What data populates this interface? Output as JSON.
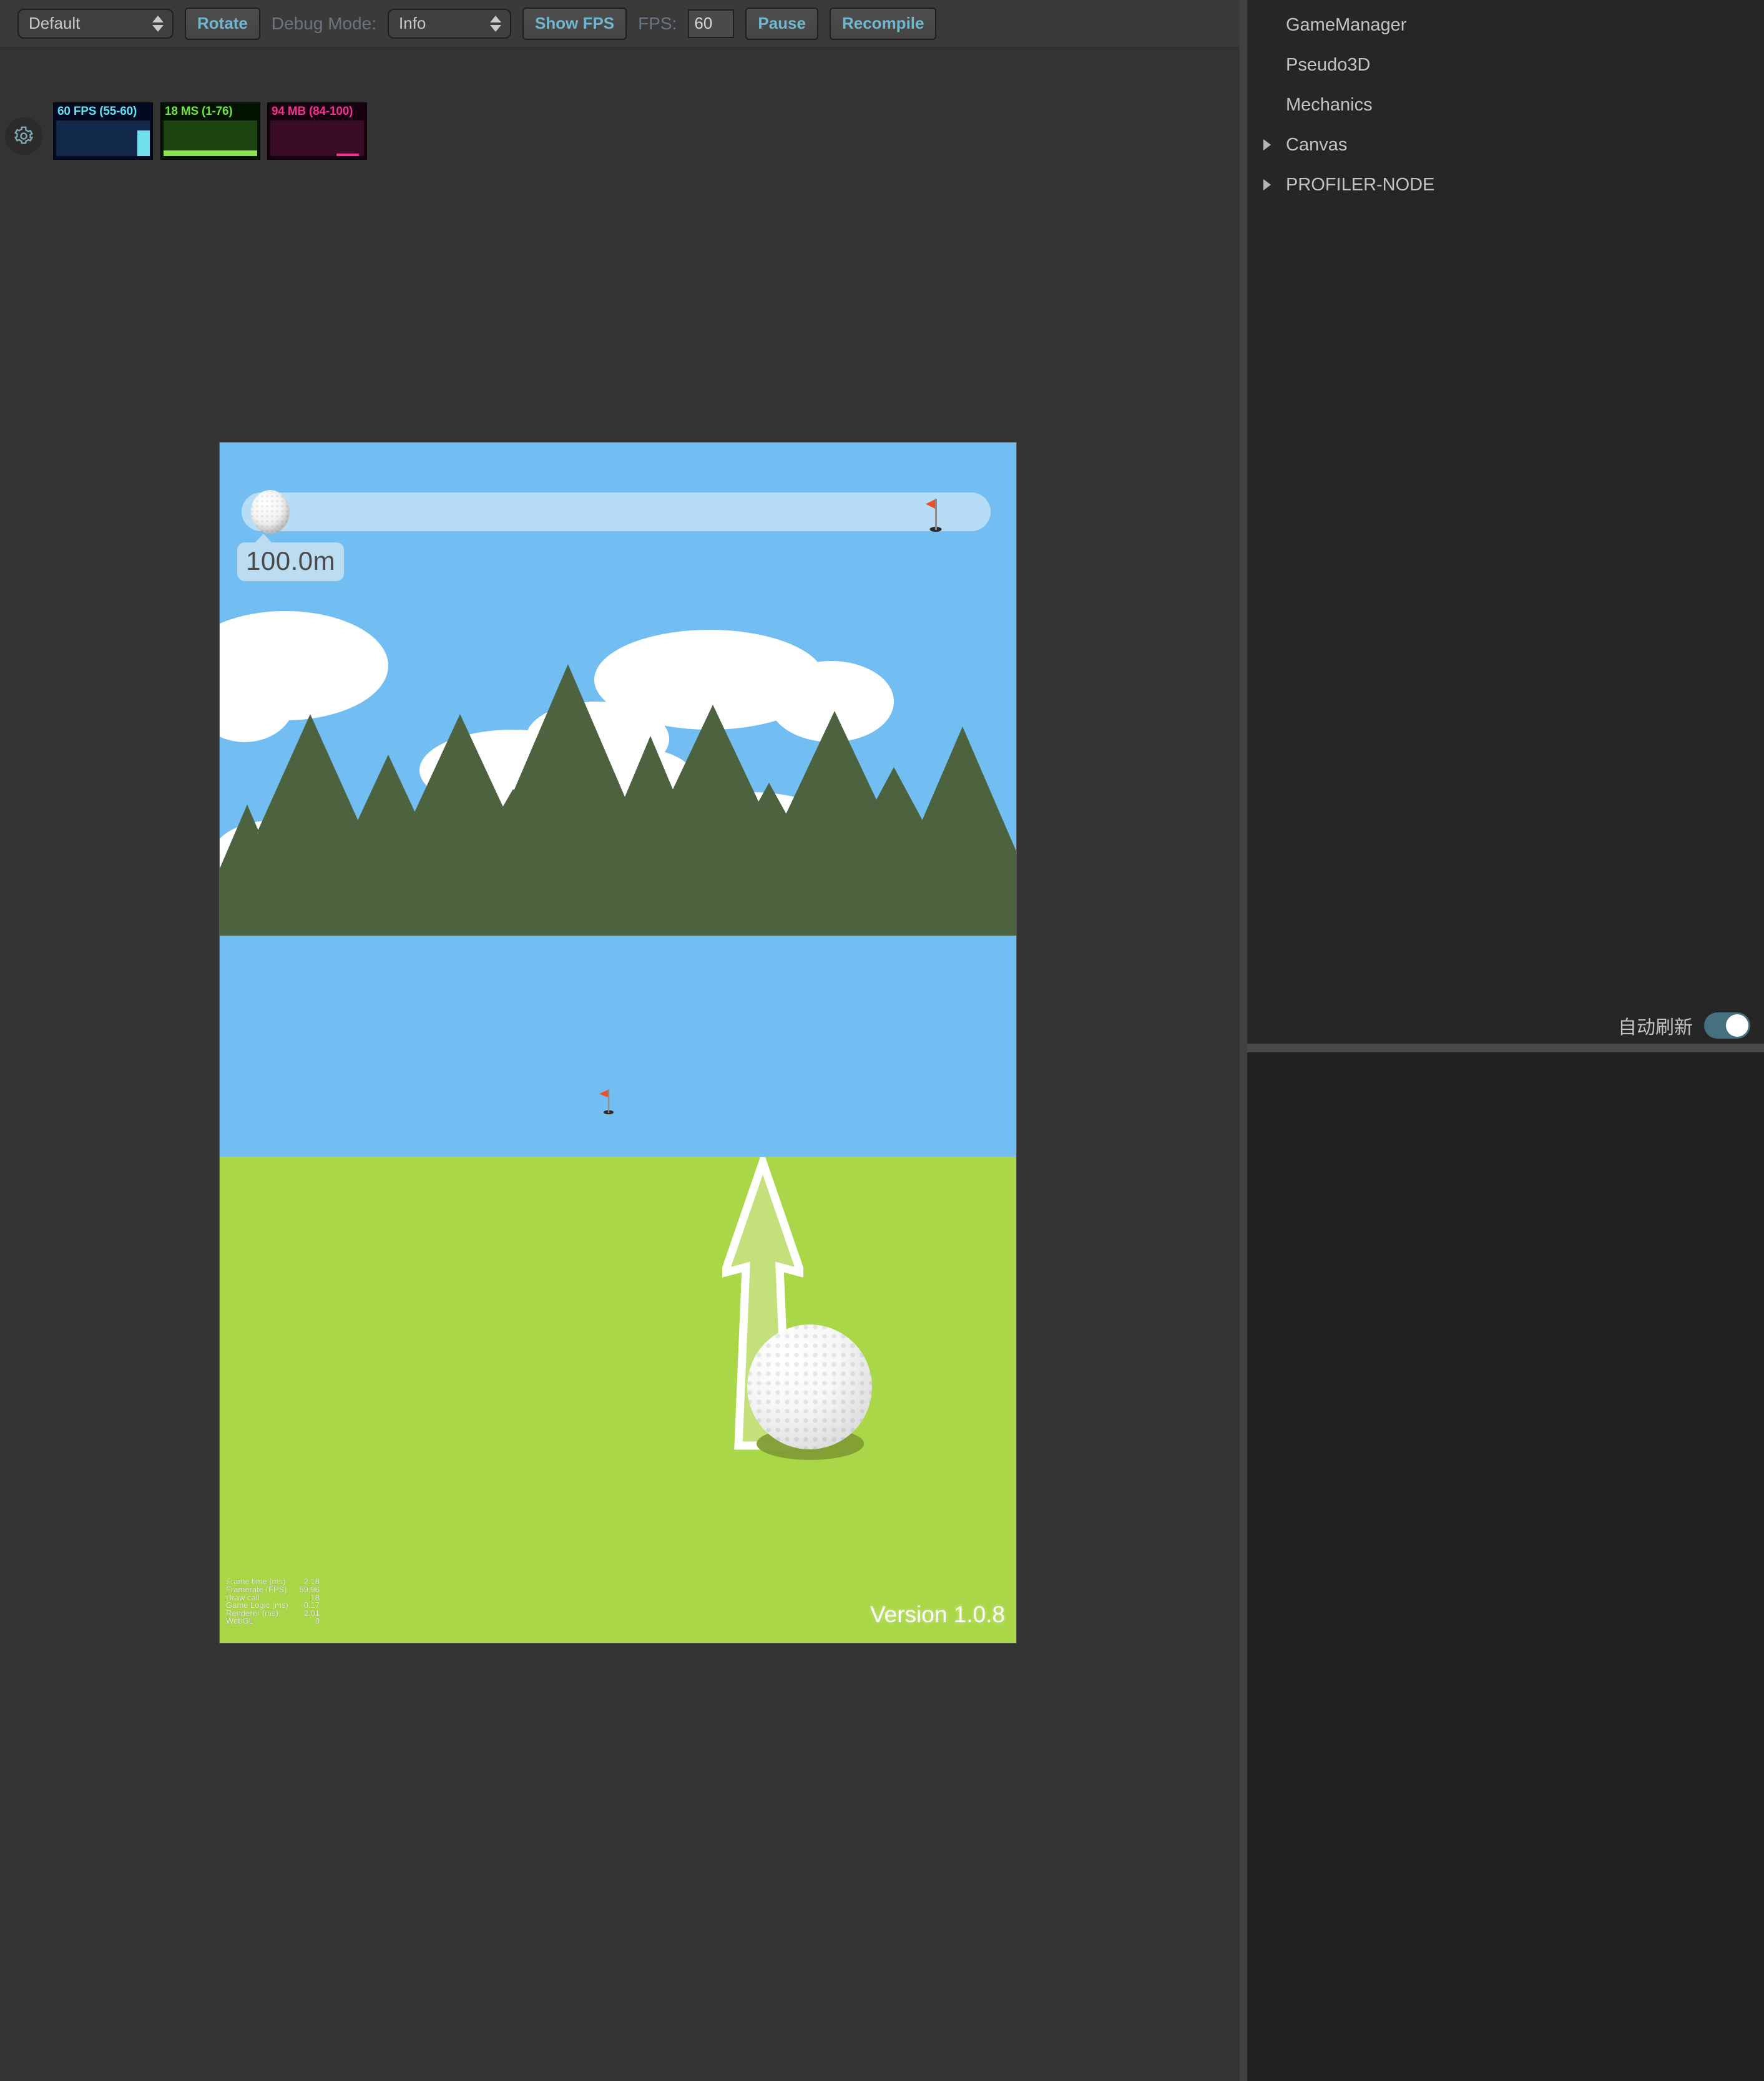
{
  "toolbar": {
    "scene_select": {
      "value": "Default",
      "icon": "chevron-updown-icon"
    },
    "rotate_button": "Rotate",
    "debug_mode_label": "Debug Mode:",
    "debug_mode_select": {
      "value": "Info"
    },
    "show_fps_button": "Show FPS",
    "fps_label": "FPS:",
    "fps_value": "60",
    "pause_button": "Pause",
    "recompile_button": "Recompile",
    "accent_color": "#6fb6cf"
  },
  "stats": {
    "gear_icon": "gear-icon",
    "panels": [
      {
        "id": "fps",
        "title": "60 FPS (55-60)",
        "color": "#5fe3f2",
        "bg": "#020a22"
      },
      {
        "id": "ms",
        "title": "18 MS (1-76)",
        "color": "#72e23f",
        "bg": "#021400"
      },
      {
        "id": "mb",
        "title": "94 MB (84-100)",
        "color": "#f1318e",
        "bg": "#180211"
      }
    ]
  },
  "game": {
    "distance_label": "100.0m",
    "version_label": "Version 1.0.8",
    "sky_color": "#72bdf2",
    "ground_color": "#a9d747",
    "tree_color": "#4d6340",
    "flag_color": "#f04e23",
    "progress_track_color": "#b6dcf6",
    "profiler": {
      "rows": [
        {
          "key": "Frame time (ms)",
          "value": "2.18"
        },
        {
          "key": "Framerate (FPS)",
          "value": "59.96"
        },
        {
          "key": "Draw call",
          "value": "18"
        },
        {
          "key": "Game Logic (ms)",
          "value": "0.17"
        },
        {
          "key": "Renderer (ms)",
          "value": "2.01"
        },
        {
          "key": "WebGL",
          "value": "0"
        }
      ]
    }
  },
  "inspector": {
    "tree": [
      {
        "label": "GameManager",
        "expandable": false
      },
      {
        "label": "Pseudo3D",
        "expandable": false
      },
      {
        "label": "Mechanics",
        "expandable": false
      },
      {
        "label": "Canvas",
        "expandable": true
      },
      {
        "label": "PROFILER-NODE",
        "expandable": true
      }
    ],
    "auto_refresh_label": "自动刷新",
    "auto_refresh_on": true,
    "toggle_on_color": "#46707f"
  }
}
